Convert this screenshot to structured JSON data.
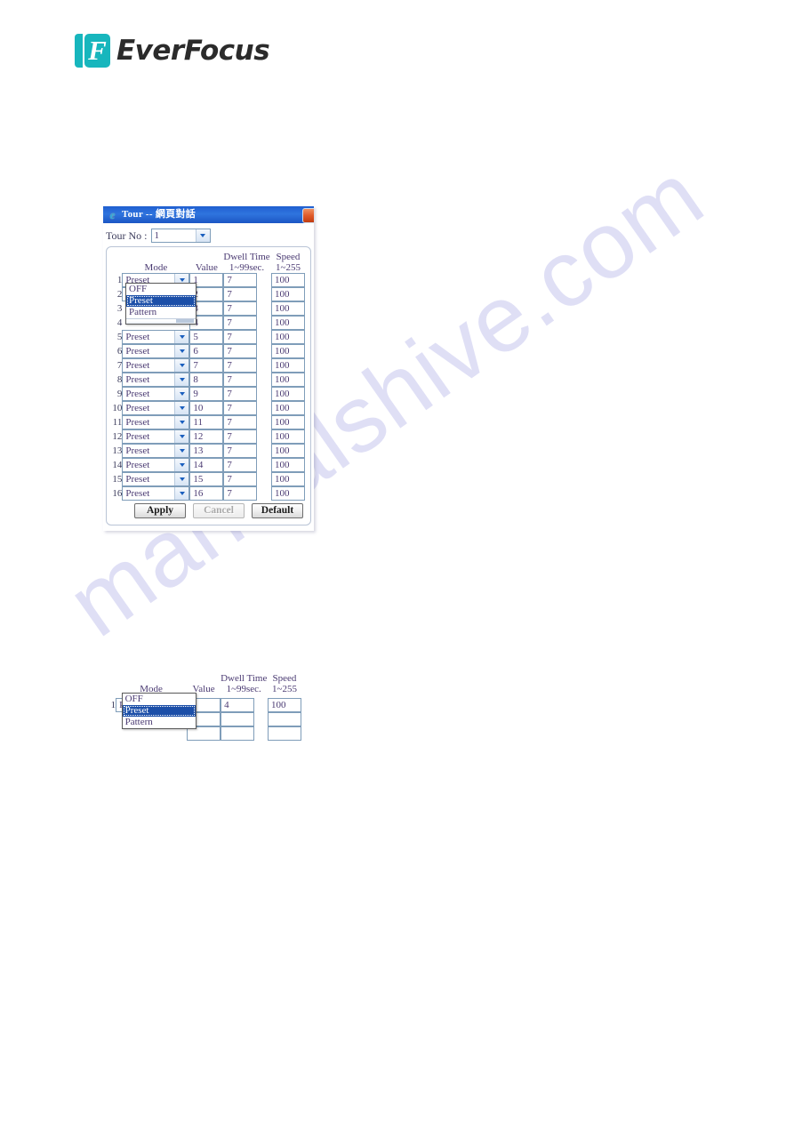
{
  "brand": {
    "logo_letter": "F",
    "name": "EverFocus",
    "accent_color": "#17b6bd"
  },
  "watermark": {
    "text": "manualshive.com",
    "color": "#ccccf0"
  },
  "dialog": {
    "icon": "internet-explorer-icon",
    "icon_glyph": "e",
    "title": "Tour -- 網頁對話",
    "close_label": "",
    "tour_no": {
      "label": "Tour No :",
      "value": "1"
    },
    "headers": {
      "mode": "Mode",
      "value": "Value",
      "dwell_line1": "Dwell Time",
      "dwell_line2": "1~99sec.",
      "speed_line1": "Speed",
      "speed_line2": "1~255"
    },
    "mode_options": [
      "OFF",
      "Preset",
      "Pattern"
    ],
    "open_dropdown": {
      "row": 2,
      "selected": "Preset",
      "options": [
        "OFF",
        "Preset",
        "Pattern"
      ]
    },
    "rows": [
      {
        "no": "1",
        "mode": "Preset",
        "value": "1",
        "dwell": "7",
        "speed": "100"
      },
      {
        "no": "2",
        "mode": "Preset",
        "value": "2",
        "dwell": "7",
        "speed": "100"
      },
      {
        "no": "3",
        "mode": "Preset",
        "value": "3",
        "dwell": "7",
        "speed": "100"
      },
      {
        "no": "4",
        "mode": "Preset",
        "value": "4",
        "dwell": "7",
        "speed": "100"
      },
      {
        "no": "5",
        "mode": "Preset",
        "value": "5",
        "dwell": "7",
        "speed": "100"
      },
      {
        "no": "6",
        "mode": "Preset",
        "value": "6",
        "dwell": "7",
        "speed": "100"
      },
      {
        "no": "7",
        "mode": "Preset",
        "value": "7",
        "dwell": "7",
        "speed": "100"
      },
      {
        "no": "8",
        "mode": "Preset",
        "value": "8",
        "dwell": "7",
        "speed": "100"
      },
      {
        "no": "9",
        "mode": "Preset",
        "value": "9",
        "dwell": "7",
        "speed": "100"
      },
      {
        "no": "10",
        "mode": "Preset",
        "value": "10",
        "dwell": "7",
        "speed": "100"
      },
      {
        "no": "11",
        "mode": "Preset",
        "value": "11",
        "dwell": "7",
        "speed": "100"
      },
      {
        "no": "12",
        "mode": "Preset",
        "value": "12",
        "dwell": "7",
        "speed": "100"
      },
      {
        "no": "13",
        "mode": "Preset",
        "value": "13",
        "dwell": "7",
        "speed": "100"
      },
      {
        "no": "14",
        "mode": "Preset",
        "value": "14",
        "dwell": "7",
        "speed": "100"
      },
      {
        "no": "15",
        "mode": "Preset",
        "value": "15",
        "dwell": "7",
        "speed": "100"
      },
      {
        "no": "16",
        "mode": "Preset",
        "value": "16",
        "dwell": "7",
        "speed": "100"
      }
    ],
    "buttons": {
      "apply": "Apply",
      "cancel": "Cancel",
      "default": "Default"
    }
  },
  "figure2": {
    "headers": {
      "mode": "Mode",
      "value": "Value",
      "dwell_line1": "Dwell Time",
      "dwell_line2": "1~99sec.",
      "speed_line1": "Speed",
      "speed_line2": "1~255"
    },
    "row": {
      "no": "1",
      "mode": "Preset",
      "value": "1",
      "dwell": "4",
      "speed": "100"
    },
    "open_dropdown": {
      "selected": "Preset",
      "options": [
        "OFF",
        "Preset",
        "Pattern"
      ]
    },
    "empty_rows": [
      {
        "value": "",
        "dwell": "",
        "speed": ""
      },
      {
        "value": "",
        "dwell": "",
        "speed": ""
      }
    ]
  }
}
